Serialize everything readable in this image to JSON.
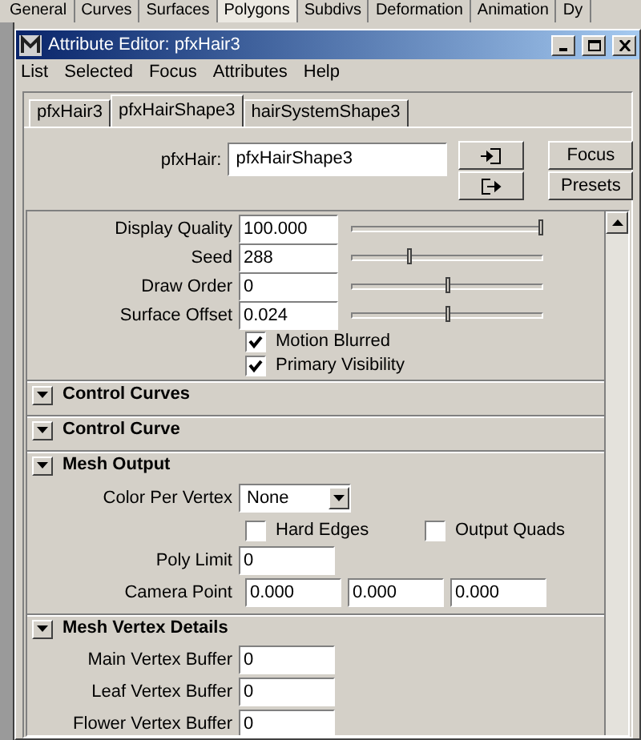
{
  "shelf_tabs": [
    {
      "label": "General",
      "selected": false
    },
    {
      "label": "Curves",
      "selected": false
    },
    {
      "label": "Surfaces",
      "selected": false
    },
    {
      "label": "Polygons",
      "selected": true
    },
    {
      "label": "Subdivs",
      "selected": false
    },
    {
      "label": "Deformation",
      "selected": false
    },
    {
      "label": "Animation",
      "selected": false
    },
    {
      "label": "Dy",
      "selected": false
    }
  ],
  "window": {
    "title": "Attribute Editor: pfxHair3"
  },
  "menu": [
    "List",
    "Selected",
    "Focus",
    "Attributes",
    "Help"
  ],
  "tabs": [
    {
      "label": "pfxHair3",
      "selected": false
    },
    {
      "label": "pfxHairShape3",
      "selected": true
    },
    {
      "label": "hairSystemShape3",
      "selected": false
    }
  ],
  "node": {
    "label": "pfxHair:",
    "value": "pfxHairShape3",
    "buttons": [
      "Focus",
      "Presets"
    ]
  },
  "attributes": [
    {
      "kind": "slider",
      "label": "Display Quality",
      "value": "100.000",
      "level": 1.0
    },
    {
      "kind": "slider",
      "label": "Seed",
      "value": "288",
      "level": 0.3
    },
    {
      "kind": "slider",
      "label": "Draw Order",
      "value": "0",
      "level": 0.5
    },
    {
      "kind": "slider",
      "label": "Surface Offset",
      "value": "0.024",
      "level": 0.5
    },
    {
      "kind": "checkbox",
      "label": "Motion Blurred",
      "checked": true
    },
    {
      "kind": "checkbox",
      "label": "Primary Visibility",
      "checked": true
    }
  ],
  "sections": [
    {
      "title": "Control Curves",
      "expanded": true
    },
    {
      "title": "Control Curve",
      "expanded": true
    },
    {
      "title": "Mesh Output",
      "expanded": true,
      "rows": [
        {
          "kind": "dropdown",
          "label": "Color Per Vertex",
          "value": "None"
        },
        {
          "kind": "checkbox_pair",
          "items": [
            {
              "label": "Hard Edges",
              "checked": false
            },
            {
              "label": "Output Quads",
              "checked": false
            }
          ]
        },
        {
          "kind": "field",
          "label": "Poly Limit",
          "value": "0"
        },
        {
          "kind": "vector",
          "label": "Camera Point",
          "values": [
            "0.000",
            "0.000",
            "0.000"
          ]
        }
      ]
    },
    {
      "title": "Mesh Vertex Details",
      "expanded": true,
      "rows": [
        {
          "kind": "field",
          "label": "Main Vertex Buffer",
          "value": "0"
        },
        {
          "kind": "field",
          "label": "Leaf Vertex Buffer",
          "value": "0"
        },
        {
          "kind": "field",
          "label": "Flower Vertex Buffer",
          "value": "0"
        }
      ]
    }
  ]
}
